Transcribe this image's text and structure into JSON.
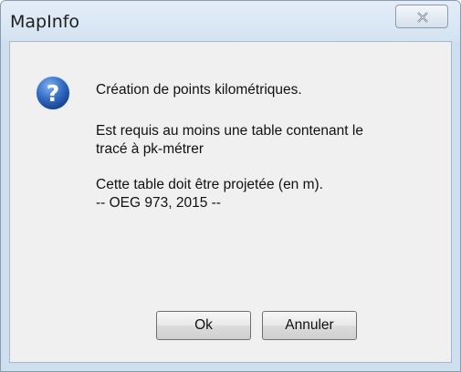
{
  "window": {
    "title": "MapInfo"
  },
  "message": {
    "line1": "Création de points kilométriques.",
    "line2a": "Est requis au moins une table contenant le",
    "line2b": "tracé à pk-métrer",
    "line3": "Cette table doit être projetée (en m).",
    "line4": "-- OEG 973, 2015 --"
  },
  "buttons": {
    "ok_label": "Ok",
    "cancel_label": "Annuler"
  },
  "icons": {
    "close": "close-icon",
    "question": "question-icon"
  },
  "colors": {
    "title_bar": "#d4e3f2",
    "client_bg": "#f0f0f0",
    "question_icon": "#2f67c0"
  }
}
